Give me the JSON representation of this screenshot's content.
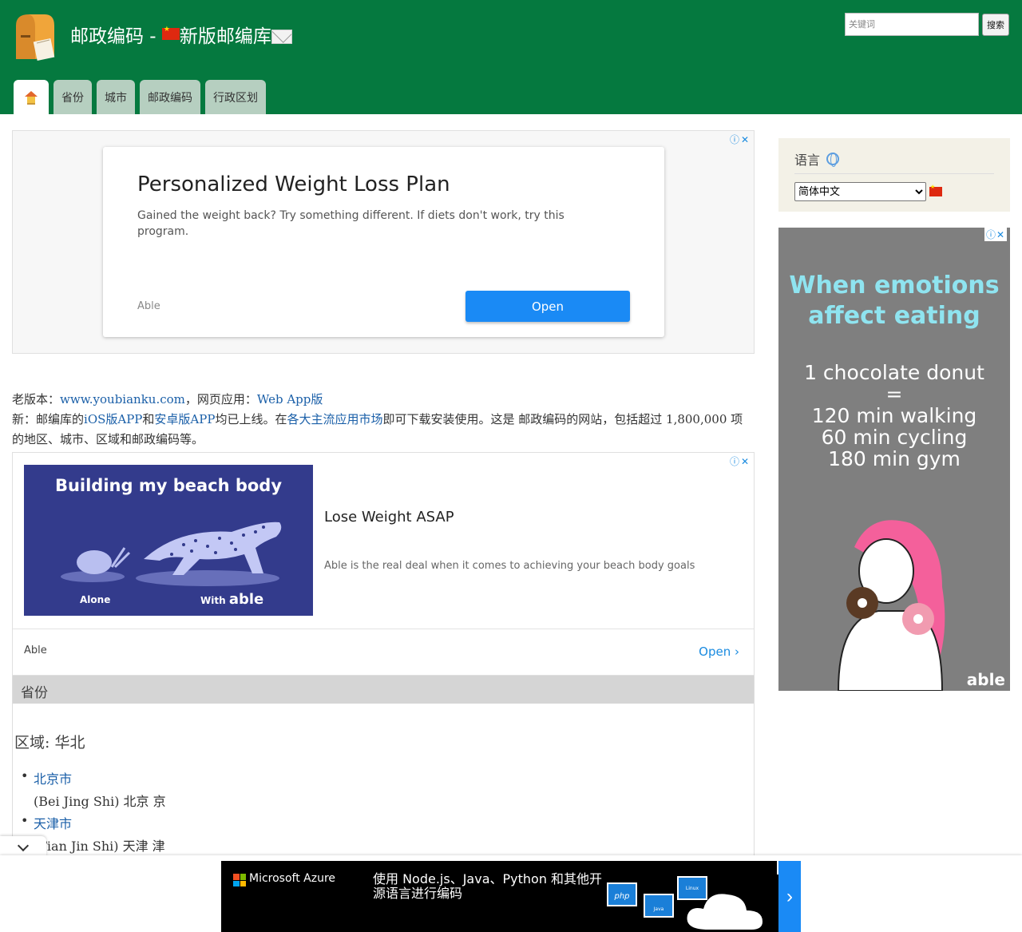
{
  "header": {
    "title": "邮政编码 - ",
    "title_suffix": "新版邮编库",
    "search_placeholder": "关键词",
    "search_button": "搜索"
  },
  "nav": {
    "tabs": [
      {
        "label": "省份"
      },
      {
        "label": "城市"
      },
      {
        "label": "邮政编码"
      },
      {
        "label": "行政区划"
      }
    ]
  },
  "ad_top": {
    "title": "Personalized Weight Loss Plan",
    "description": "Gained the weight back? Try something different. If diets don't work, try this program.",
    "brand": "Able",
    "cta": "Open"
  },
  "intro": {
    "old_version_label": "老版本：",
    "old_version_link": "www.youbianku.com",
    "web_app_label": "，网页应用：",
    "web_app_link": "Web App版",
    "new_prefix": "新：邮编库的",
    "ios_link": "iOS版APP",
    "and_text": "和",
    "android_link": "安卓版APP",
    "launched_text": "均已上线。在",
    "stores_link": "各大主流应用市场",
    "rest_text": "即可下载安装使用。这是 邮政编码的网站，包括超过 1,800,000 项的地区、城市、区域和邮政编码等。"
  },
  "ad_middle": {
    "image_title": "Building my beach body",
    "alone_label": "Alone",
    "with_label": "With ",
    "with_brand": "able",
    "title": "Lose Weight ASAP",
    "description": "Able is the real deal when it comes to achieving your beach body goals",
    "brand": "Able",
    "cta": "Open ›"
  },
  "province_section": {
    "header": "省份",
    "region": "区域: 华北",
    "items": [
      {
        "name": "北京市",
        "pinyin": "(Bei Jing Shi) 北京 京"
      },
      {
        "name": "天津市",
        "pinyin": "(Tian Jin Shi) 天津 津"
      }
    ]
  },
  "sidebar": {
    "language_title": "语言",
    "language_selected": "简体中文"
  },
  "side_ad": {
    "headline_1": "When emotions",
    "headline_2": "affect eating",
    "line_1": "1 chocolate donut",
    "line_2": "=",
    "line_3": "120 min walking",
    "line_4": "60 min cycling",
    "line_5": "180 min gym",
    "brand": "able"
  },
  "bottom_ad": {
    "brand": "Microsoft Azure",
    "text": "使用 Node.js、Java、Python 和其他开源语言进行编码",
    "php_label": "php",
    "java_label": "Java",
    "linux_label": "Linux"
  },
  "ad_choices_label": "ⓘ✕",
  "colors": {
    "header_green": "#05793f",
    "tab_bg": "#b6cfc0",
    "link_blue": "#1a5fa8",
    "ad_button_blue": "#1a8af5"
  }
}
